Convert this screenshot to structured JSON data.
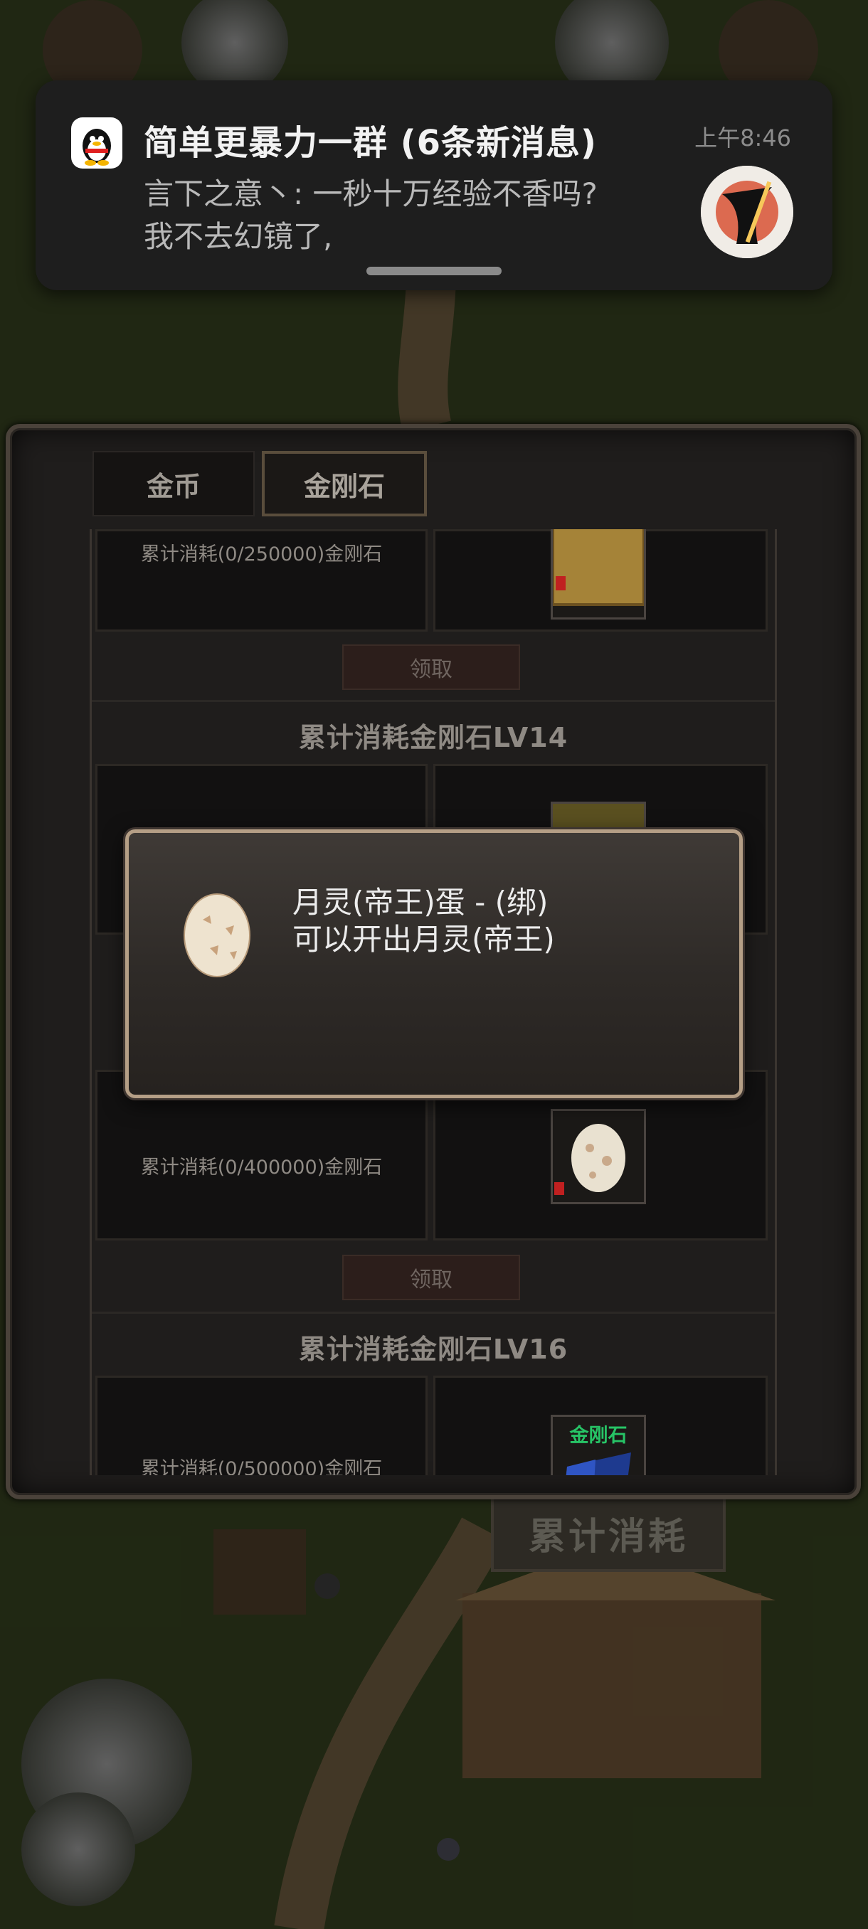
{
  "notification": {
    "app_icon": "qq-penguin-icon",
    "title": "简单更暴力一群 (6条新消息)",
    "time": "上午8:46",
    "line1": "言下之意丶: 一秒十万经验不香吗?",
    "line2": "我不去幻镜了,",
    "avatar_icon": "warrior-avatar-icon"
  },
  "tabs": [
    {
      "label": "金币"
    },
    {
      "label": "金刚石"
    }
  ],
  "rows": [
    {
      "requirement": "累计消耗(0/250000)金刚石",
      "claim": "领取"
    },
    {
      "section_title": "累计消耗金刚石LV14"
    },
    {
      "requirement": "累计消耗(0/400000)金刚石",
      "claim": "领取"
    },
    {
      "section_title": "累计消耗金刚石LV16"
    },
    {
      "requirement": "累计消耗(0/500000)金刚石",
      "reward_label": "金刚石"
    }
  ],
  "popup": {
    "item_name": "月灵(帝王)蛋 - (绑)",
    "item_desc": "可以开出月灵(帝王)",
    "item_icon": "egg-icon"
  },
  "building_sign": "累计消耗",
  "colors": {
    "panel_bg": "#1f1d1c",
    "popup_border": "#b59f86",
    "notification_bg": "#1e1e1e",
    "green_label": "#27c466"
  }
}
